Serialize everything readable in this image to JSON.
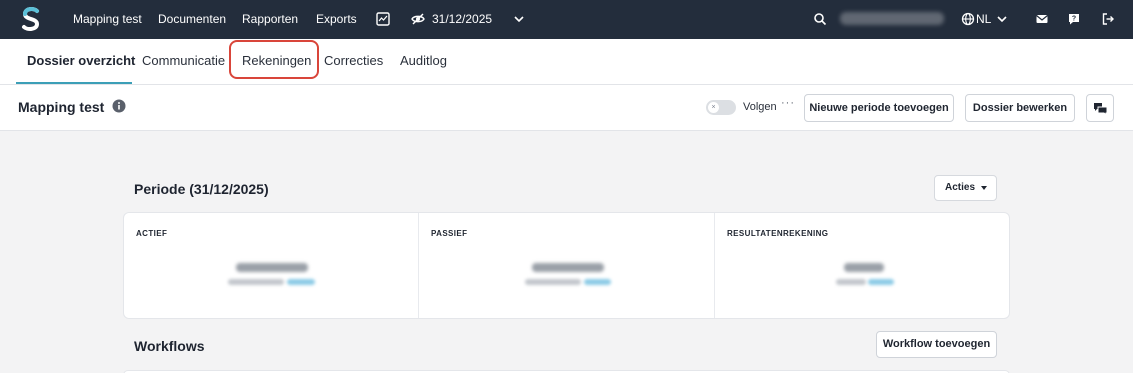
{
  "topbar": {
    "nav": [
      "Mapping test",
      "Documenten",
      "Rapporten",
      "Exports"
    ],
    "period": "31/12/2025",
    "language": "NL"
  },
  "tabs": [
    "Dossier overzicht",
    "Communicatie",
    "Rekeningen",
    "Correcties",
    "Auditlog"
  ],
  "header": {
    "title": "Mapping test",
    "follow_label": "Volgen",
    "more_label": "···",
    "toggle_mark": "×",
    "new_period_button": "Nieuwe periode toevoegen",
    "edit_button": "Dossier bewerken"
  },
  "period_section": {
    "title": "Periode (31/12/2025)",
    "actions_button": "Acties",
    "columns": [
      "ACTIEF",
      "PASSIEF",
      "RESULTATENREKENING"
    ]
  },
  "workflows": {
    "title": "Workflows",
    "add_button": "Workflow toevoegen"
  },
  "colors": {
    "nav_bg": "#232d3c",
    "accent": "#3c9fb7",
    "highlight": "#d9453a"
  }
}
